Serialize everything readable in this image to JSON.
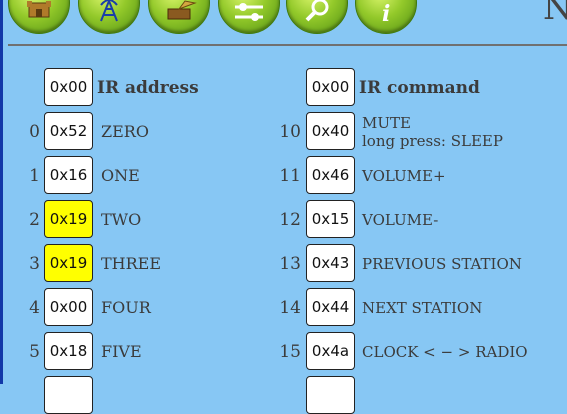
{
  "toolbar": {
    "buttons": [
      {
        "name": "castle-icon"
      },
      {
        "name": "radio-tower-icon"
      },
      {
        "name": "gramophone-icon"
      },
      {
        "name": "settings-sliders-icon"
      },
      {
        "name": "magnifier-icon"
      },
      {
        "name": "info-icon"
      }
    ],
    "corner_text": "N"
  },
  "left": {
    "header_value": "0x00",
    "header_label": "IR address",
    "rows": [
      {
        "index": "0",
        "value": "0x52",
        "label": "ZERO",
        "highlight": false
      },
      {
        "index": "1",
        "value": "0x16",
        "label": "ONE",
        "highlight": false
      },
      {
        "index": "2",
        "value": "0x19",
        "label": "TWO",
        "highlight": true
      },
      {
        "index": "3",
        "value": "0x19",
        "label": "THREE",
        "highlight": true
      },
      {
        "index": "4",
        "value": "0x00",
        "label": "FOUR",
        "highlight": false
      },
      {
        "index": "5",
        "value": "0x18",
        "label": "FIVE",
        "highlight": false
      }
    ]
  },
  "right": {
    "header_value": "0x00",
    "header_label": "IR command",
    "rows": [
      {
        "index": "10",
        "value": "0x40",
        "label": "MUTE",
        "sublabel": "long press: SLEEP"
      },
      {
        "index": "11",
        "value": "0x46",
        "label": "VOLUME+"
      },
      {
        "index": "12",
        "value": "0x15",
        "label": "VOLUME-"
      },
      {
        "index": "13",
        "value": "0x43",
        "label": "PREVIOUS STATION"
      },
      {
        "index": "14",
        "value": "0x44",
        "label": "NEXT STATION"
      },
      {
        "index": "15",
        "value": "0x4a",
        "label": "CLOCK < − > RADIO"
      }
    ]
  }
}
